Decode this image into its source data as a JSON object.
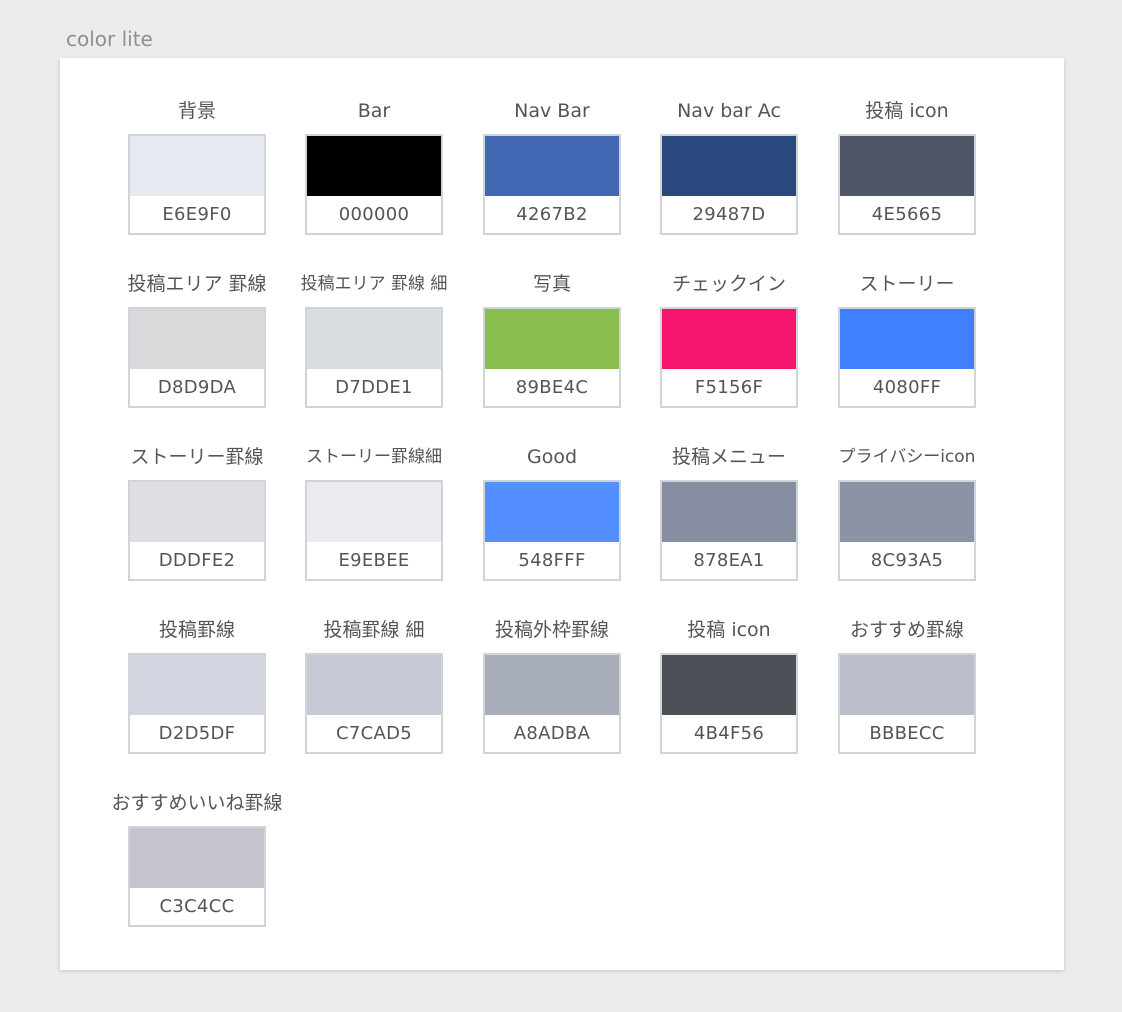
{
  "frame_title": "color lite",
  "swatches": [
    {
      "label": "背景",
      "hex": "E6E9F0"
    },
    {
      "label": "Bar",
      "hex": "000000"
    },
    {
      "label": "Nav Bar",
      "hex": "4267B2"
    },
    {
      "label": "Nav bar Ac",
      "hex": "29487D"
    },
    {
      "label": "投稿 icon",
      "hex": "4E5665"
    },
    {
      "label": "投稿エリア 罫線",
      "hex": "D8D9DA"
    },
    {
      "label": "投稿エリア 罫線 細",
      "hex": "D7DDE1"
    },
    {
      "label": "写真",
      "hex": "89BE4C"
    },
    {
      "label": "チェックイン",
      "hex": "F5156F"
    },
    {
      "label": "ストーリー",
      "hex": "4080FF"
    },
    {
      "label": "ストーリー罫線",
      "hex": "DDDFE2"
    },
    {
      "label": "ストーリー罫線細",
      "hex": "E9EBEE"
    },
    {
      "label": "Good",
      "hex": "548FFF"
    },
    {
      "label": "投稿メニュー",
      "hex": "878EA1"
    },
    {
      "label": "プライバシーicon",
      "hex": "8C93A5"
    },
    {
      "label": "投稿罫線",
      "hex": "D2D5DF"
    },
    {
      "label": "投稿罫線 細",
      "hex": "C7CAD5"
    },
    {
      "label": "投稿外枠罫線",
      "hex": "A8ADBA"
    },
    {
      "label": "投稿 icon",
      "hex": "4B4F56"
    },
    {
      "label": "おすすめ罫線",
      "hex": "BBBECC"
    },
    {
      "label": "おすすめいいね罫線",
      "hex": "C3C4CC"
    }
  ]
}
